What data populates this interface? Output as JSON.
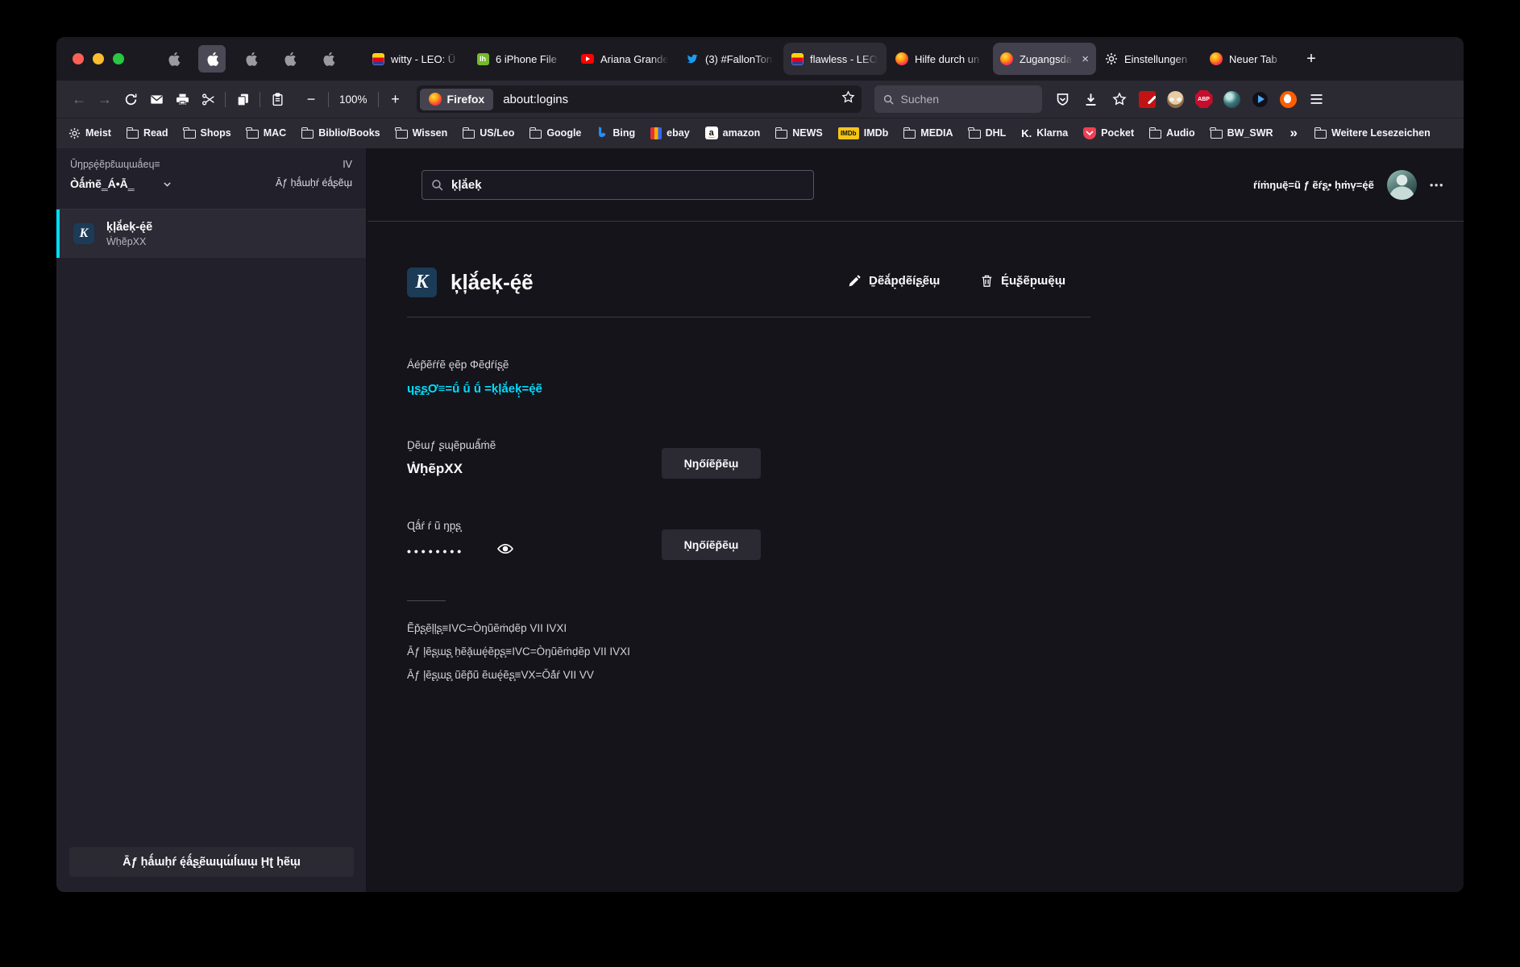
{
  "colors": {
    "accent_link": "#00ddff",
    "toolbar_bg": "#2b2a33",
    "content_bg": "#15141a",
    "sidebar_bg": "#22212b"
  },
  "icons": {
    "back": "←",
    "forward": "→",
    "zoom_out": "−",
    "zoom_in": "+",
    "close_tab": "×",
    "new_tab": "+",
    "meatballs": "•••",
    "bookmarks_overflow": "»",
    "k_letter": "K",
    "lh_label": "lh",
    "amazon_letter": "a",
    "imdb_label": "IMDb",
    "klarna_label": "K.",
    "abp_label": "ABP"
  },
  "chrome": {
    "tabs": [
      {
        "label": "witty - LEO: Ü",
        "icon": "leo"
      },
      {
        "label": "6 iPhone File",
        "icon": "lh"
      },
      {
        "label": "Ariana Grande",
        "icon": "youtube"
      },
      {
        "label": "(3) #FallonTon",
        "icon": "twitter"
      },
      {
        "label": "flawless - LEO",
        "icon": "leo"
      },
      {
        "label": "Hilfe durch un",
        "icon": "firefox"
      },
      {
        "label": "Zugangsda",
        "icon": "firefox"
      },
      {
        "label": "Einstellungen",
        "icon": "gear"
      },
      {
        "label": "Neuer Tab",
        "icon": "firefox"
      }
    ],
    "toolbar": {
      "zoom_level": "100%",
      "chip": "Firefox",
      "url": "about:logins",
      "search_placeholder": "Suchen"
    },
    "bookmarks": [
      {
        "label": "Meist"
      },
      {
        "label": "Read"
      },
      {
        "label": "Shops"
      },
      {
        "label": "MAC"
      },
      {
        "label": "Biblio/Books"
      },
      {
        "label": "Wissen"
      },
      {
        "label": "US/Leo"
      },
      {
        "label": "Google"
      },
      {
        "label": "Bing"
      },
      {
        "label": "ebay"
      },
      {
        "label": "amazon"
      },
      {
        "label": "NEWS"
      },
      {
        "label": "IMDb"
      },
      {
        "label": "MEDIA"
      },
      {
        "label": "DHL"
      },
      {
        "label": "Klarna"
      },
      {
        "label": "Pocket"
      },
      {
        "label": "Audio"
      },
      {
        "label": "BW_SWR"
      },
      {
        "label": "Weitere Lesezeichen"
      }
    ]
  },
  "sidebar": {
    "sort_label": "Ŭŋpʂę́ẽpɛ̃ɯɥɯǻeɥ≡",
    "sort_value": "Òǻṁẽ‗Á•Ā‗",
    "count": "IV",
    "show_all_link": "Āƒ ḥǻɯḥŕ éǻʂẽɯ̦",
    "item": {
      "title": "ķļǎ́eķ-ę́ẽ",
      "subtitle": "ẆḥẽpXX"
    },
    "bottom_button": "Āƒ ḥǻɯḥŕ ę́ǻʂ̧ẽɯɥɯ́ĺɯɯ̟ Ḩʈ ḥẽɯ̦"
  },
  "main": {
    "search_value": "ķļǎ́eķ̦",
    "account_name": "ŕíṁŋuę̃=ũ ƒ ẽŕʂ̧•  ḥṁv̟=ę́ẽ",
    "title": "ķļǎ́eķ-ę́ẽ",
    "edit_button": "Ḏẽǎ́p̣ḍẽíʂ̧ẽɯ̦",
    "delete_button": "Ę́uʂ̌ẽp̣ɯę̃ɯ̦",
    "website_label": "Áép̃ẽŕŕẽ ęẽp Φẽḍŕíʂ̧ẽ",
    "website_link": "ɥʂ̧ʂ̧Ơ≡=ṹ ṹ ṹ =ķļǎ́eķ̦=ę́ẽ",
    "username_label": "Ḏẽɯƒ ʂɰẽpɯǻ́ṁẽ",
    "username_value": "ẆḥẽpXX",
    "copy_button": "Ṇŋőíẽp̃ẽɯ̦",
    "password_label": "Ɋǻŕ ŕ ũ ŋp̣ʂ̧",
    "password_dots": "••••••••",
    "meta_created": "Ẽp̌ʂ̧ẽļļʂ̧≡IVC=Òŋũẽṁḍẽp VII IVXI",
    "meta_modified": "Āƒ ļẽʂ̧ɯʂ̧ ḥẽǎ̞ɯę́ẽp̣ʂ̧≡IVC=Òŋũẽṁḍẽp VII IVXI",
    "meta_used": "Āƒ ļẽʂ̧ɯʂ̧ ũẽp̃ũ ẽɯę́ẽʂ̧≡VX=Ǒǎ́ŕ VII VV"
  }
}
